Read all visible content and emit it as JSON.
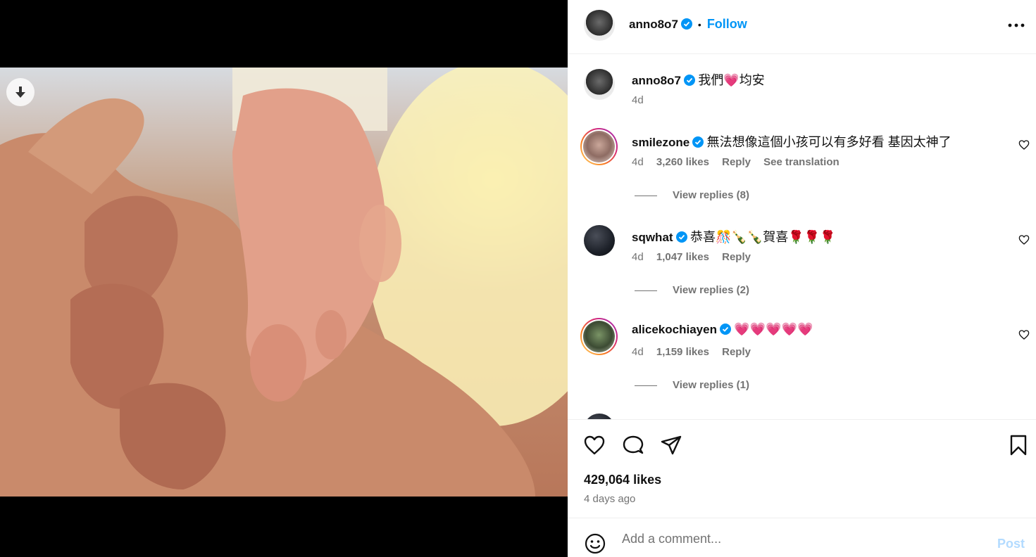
{
  "post": {
    "author": "anno8o7",
    "follow_label": "Follow",
    "dot": "•",
    "caption": "我們💗均安",
    "caption_time": "4d",
    "likes": "429,064 likes",
    "posted": "4 days ago"
  },
  "comments": [
    {
      "username": "smilezone",
      "text": "無法想像這個小孩可以有多好看 基因太神了",
      "time": "4d",
      "likes": "3,260 likes",
      "reply_label": "Reply",
      "translation_label": "See translation",
      "view_replies": "View replies (8)"
    },
    {
      "username": "sqwhat",
      "text": "恭喜🎊🍾🍾賀喜🌹🌹🌹",
      "time": "4d",
      "likes": "1,047 likes",
      "reply_label": "Reply",
      "view_replies": "View replies (2)"
    },
    {
      "username": "alicekochiayen",
      "text": "💗💗💗💗💗",
      "time": "4d",
      "likes": "1,159 likes",
      "reply_label": "Reply",
      "view_replies": "View replies (1)"
    }
  ],
  "composer": {
    "placeholder": "Add a comment...",
    "post_label": "Post"
  },
  "icons": {
    "more": "more-horizontal-icon",
    "verified": "verified-badge-icon",
    "download": "download-icon",
    "like": "heart-icon",
    "comment": "comment-icon",
    "share": "send-icon",
    "save": "bookmark-icon",
    "emoji": "smiley-icon"
  },
  "colors": {
    "accent": "#0095f6",
    "muted": "#737373",
    "post_disabled": "#b3dbff"
  }
}
